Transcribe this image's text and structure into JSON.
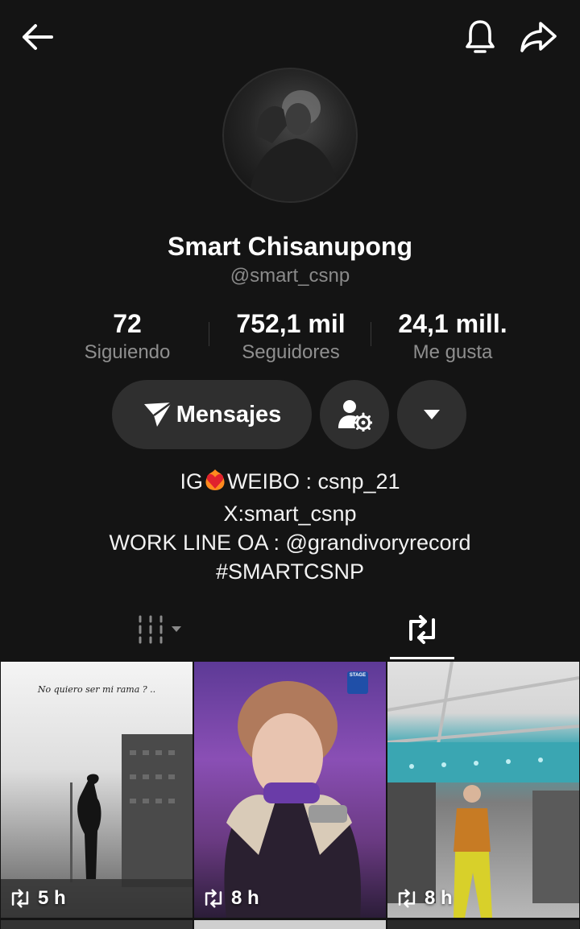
{
  "header": {
    "back_icon": "arrow-left-icon",
    "notifications_icon": "bell-icon",
    "share_icon": "share-arrow-icon"
  },
  "profile": {
    "name": "Smart Chisanupong",
    "handle": "@smart_csnp"
  },
  "stats": [
    {
      "value": "72",
      "label": "Siguiendo"
    },
    {
      "value": "752,1 mil",
      "label": "Seguidores"
    },
    {
      "value": "24,1 mill.",
      "label": "Me gusta"
    }
  ],
  "actions": {
    "messages_label": "Mensajes",
    "messages_icon": "paper-plane-icon",
    "friend_settings_icon": "person-gear-icon",
    "more_icon": "caret-down-icon"
  },
  "bio": {
    "line1_prefix": "IG",
    "line1_emoji": "flaming-heart",
    "line1_suffix": "WEIBO : csnp_21",
    "line2": "X:smart_csnp",
    "line3": "WORK LINE OA : @grandivoryrecord",
    "line4": "#SMARTCSNP"
  },
  "tabs": [
    {
      "icon": "grid-columns-icon",
      "active": false
    },
    {
      "icon": "repost-icon",
      "active": true
    }
  ],
  "videos": [
    {
      "caption": "No quiero ser mi rama ? ..",
      "time": "5 h"
    },
    {
      "badge": "STAGE",
      "time": "8 h"
    },
    {
      "time": "8 h"
    }
  ],
  "colors": {
    "background": "#141414",
    "button_bg": "#2f2f2f",
    "secondary_text": "#8f8f8f"
  }
}
